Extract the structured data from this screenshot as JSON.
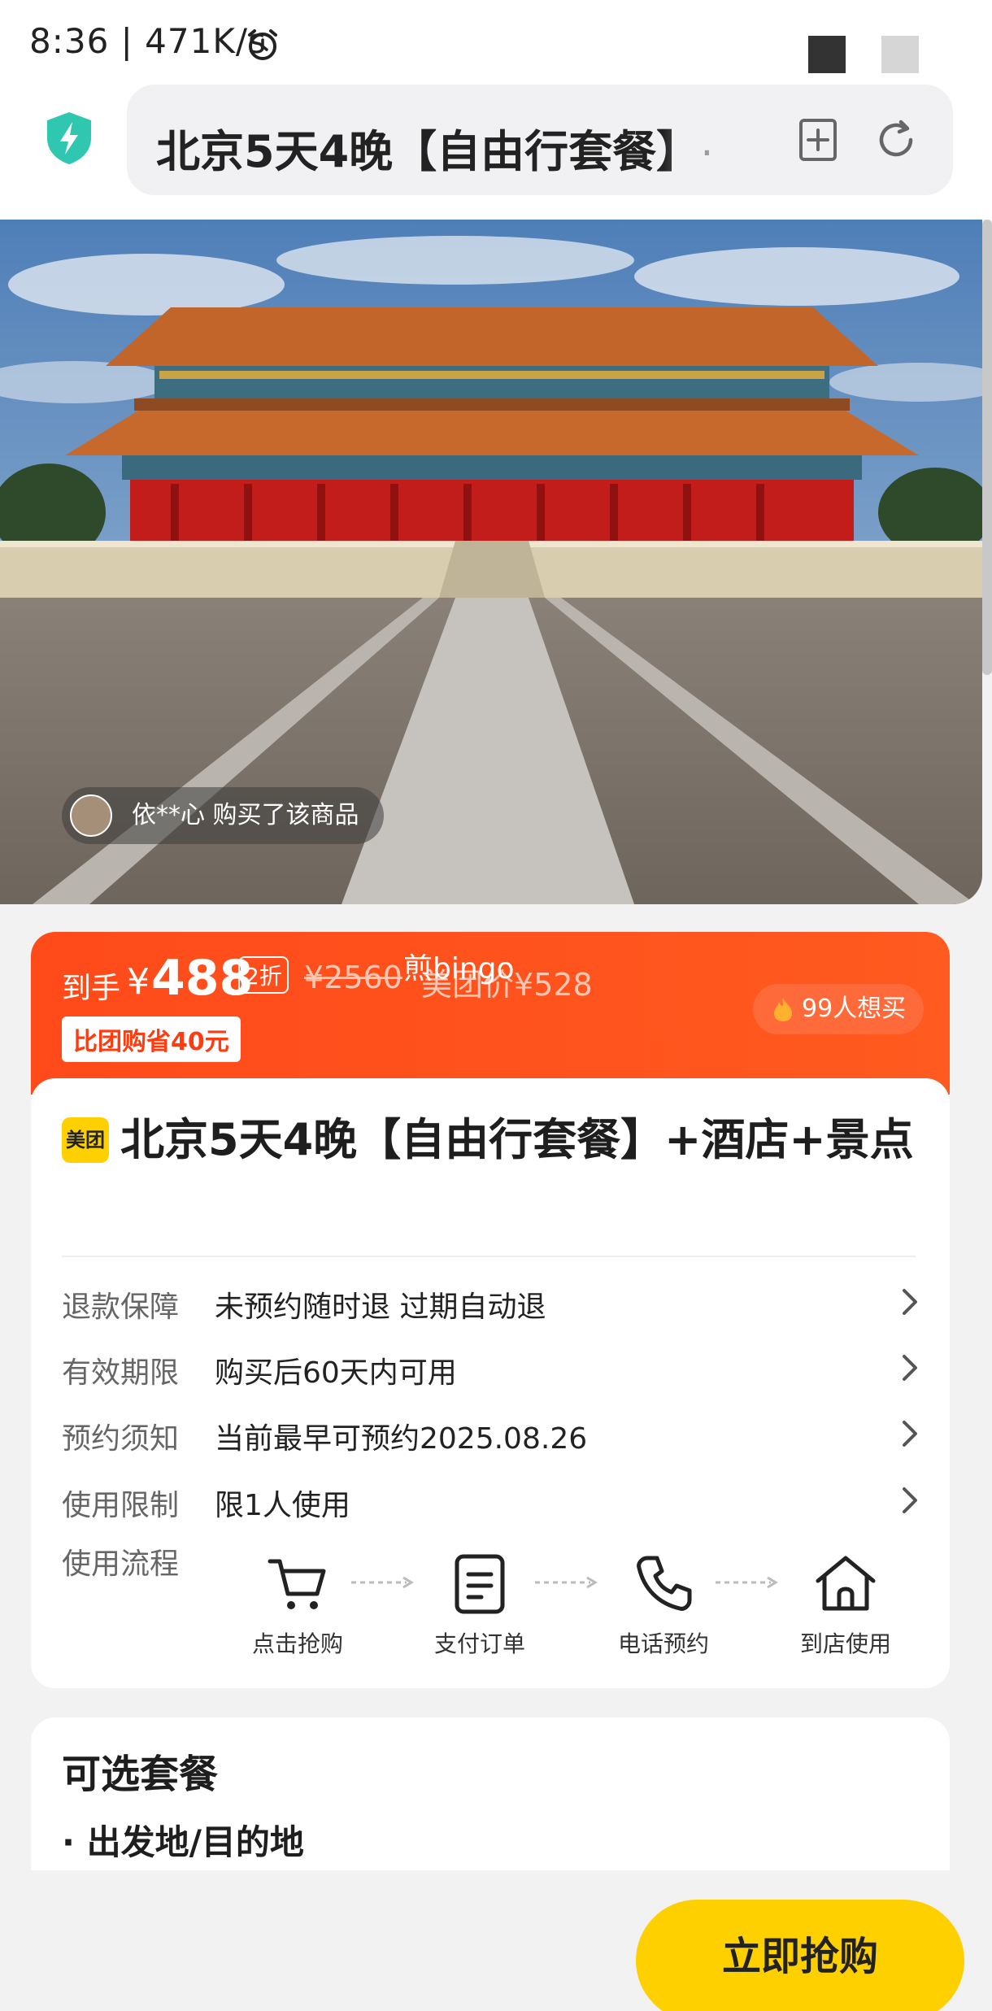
{
  "status_bar": {
    "time_speed": "8:36 | 471K/s"
  },
  "browser": {
    "title": "北京5天4晚【自由行套餐】+酒店+景点"
  },
  "hero": {
    "buyer_notice": "依**心 购买了该商品"
  },
  "price_banner": {
    "label": "到手",
    "currency": "¥",
    "price": "488",
    "discount": "2折",
    "original_price": "¥2560",
    "member_price": "美团价¥528",
    "watermark": "煎bingo",
    "savings": "比团购省40元",
    "want_count": "99人想买"
  },
  "product": {
    "brand_badge": "美团",
    "title": "北京5天4晚【自由行套餐】+酒店+景点",
    "rows": [
      {
        "label": "退款保障",
        "value": "未预约随时退 过期自动退"
      },
      {
        "label": "有效期限",
        "value": "购买后60天内可用"
      },
      {
        "label": "预约须知",
        "value": "当前最早可预约2025.08.26"
      },
      {
        "label": "使用限制",
        "value": "限1人使用"
      }
    ],
    "flow_label": "使用流程",
    "flow_steps": [
      {
        "label": "点击抢购",
        "icon": "cart-icon"
      },
      {
        "label": "支付订单",
        "icon": "document-icon"
      },
      {
        "label": "电话预约",
        "icon": "phone-icon"
      },
      {
        "label": "到店使用",
        "icon": "home-icon"
      }
    ]
  },
  "options": {
    "title": "可选套餐",
    "first_item": "· 出发地/目的地"
  },
  "cta": {
    "buy_label": "立即抢购"
  },
  "colors": {
    "accent_orange": "#ff4a1a",
    "brand_yellow": "#ffd000"
  }
}
